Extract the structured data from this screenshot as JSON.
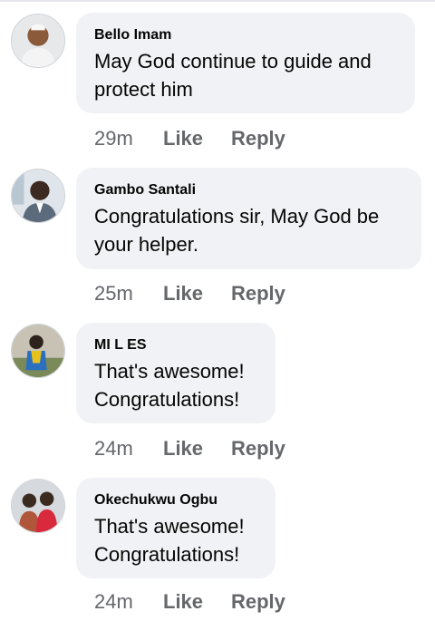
{
  "comments": [
    {
      "author": "Bello Imam",
      "text": "May God continue to guide and protect him",
      "time": "29m",
      "like": "Like",
      "reply": "Reply"
    },
    {
      "author": "Gambo Santali",
      "text": "Congratulations sir, May God be your helper.",
      "time": "25m",
      "like": "Like",
      "reply": "Reply"
    },
    {
      "author": "MI L ES",
      "text": "That's awesome! Congratulations!",
      "time": "24m",
      "like": "Like",
      "reply": "Reply"
    },
    {
      "author": "Okechukwu Ogbu",
      "text": "That's awesome! Congratulations!",
      "time": "24m",
      "like": "Like",
      "reply": "Reply"
    }
  ],
  "colors": {
    "bubble": "#f0f2f5",
    "text": "#050505",
    "meta": "#65676b"
  }
}
